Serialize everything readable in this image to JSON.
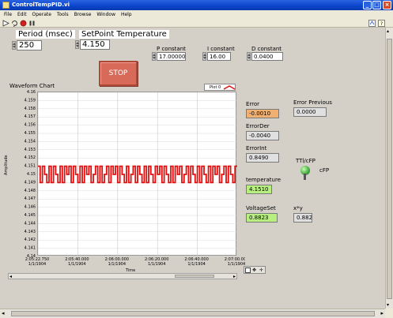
{
  "window": {
    "title": "ControlTempPID.vi",
    "minimize_glyph": "_",
    "maximize_glyph": "□",
    "close_glyph": "×"
  },
  "menu": [
    "File",
    "Edit",
    "Operate",
    "Tools",
    "Browse",
    "Window",
    "Help"
  ],
  "toolbar": {
    "icons": [
      "run-arrow-icon",
      "run-continuous-icon",
      "abort-icon",
      "pause-icon"
    ],
    "right_icons": [
      "vi-icon",
      "help-icon"
    ]
  },
  "controls": {
    "period_label": "Period (msec)",
    "period_value": "250",
    "setpoint_label": "SetPoint Temperature",
    "setpoint_value": "4.150",
    "p_label": "P constant",
    "p_value": "17.00000",
    "i_label": "I constant",
    "i_value": "16.00",
    "d_label": "D constant",
    "d_value": "0.0400",
    "stop_label": "STOP"
  },
  "indicators": {
    "error_label": "Error",
    "error_value": "-0.0010",
    "error_prev_label": "Error Previous",
    "error_prev_value": "0.0000",
    "errorder_label": "ErrorDer",
    "errorder_value": "-0.0040",
    "errorint_label": "ErrorInt",
    "errorint_value": "0.8490",
    "ttl_label": "TTl/cFP",
    "cfp_label": "cFP",
    "temperature_label": "temperature",
    "temperature_value": "4.1510",
    "voltageset_label": "VoltageSet",
    "voltageset_value": "0.8823",
    "xy_label": "x*y",
    "xy_value": "0.8823"
  },
  "colors": {
    "error_bg": "#f0b070",
    "temperature_bg": "#b8f080",
    "voltage_bg": "#b8f080",
    "readonly_bg": "#e0e0e0",
    "plot_line": "#e01010",
    "stop_button": "#d86a5a"
  },
  "chart_data": {
    "type": "line",
    "title": "Waveform Chart",
    "legend": "Plot 0",
    "ylabel": "Amplitude",
    "xlabel": "Time",
    "ylim": [
      4.14,
      4.16
    ],
    "y_ticks": [
      "4.16",
      "4.159",
      "4.158",
      "4.157",
      "4.156",
      "4.155",
      "4.154",
      "4.153",
      "4.152",
      "4.151",
      "4.15",
      "4.149",
      "4.148",
      "4.147",
      "4.146",
      "4.145",
      "4.144",
      "4.143",
      "4.142",
      "4.141",
      "4.14"
    ],
    "x_ticks": [
      {
        "time": "2:05:22.750",
        "date": "1/1/1904"
      },
      {
        "time": "2:05:40.000",
        "date": "1/1/1904"
      },
      {
        "time": "2:06:00.000",
        "date": "1/1/1904"
      },
      {
        "time": "2:06:20.000",
        "date": "1/1/1904"
      },
      {
        "time": "2:06:40.000",
        "date": "1/1/1904"
      },
      {
        "time": "2:07:00.000",
        "date": "1/1/1904"
      }
    ],
    "grid": true,
    "series": [
      {
        "values": [
          4.151,
          4.149,
          4.151,
          4.15,
          4.149,
          4.151,
          4.149,
          4.151,
          4.15,
          4.149,
          4.151,
          4.149,
          4.151,
          4.15,
          4.151,
          4.149,
          4.151,
          4.15,
          4.149,
          4.151,
          4.149,
          4.151,
          4.15,
          4.151,
          4.149,
          4.15,
          4.151,
          4.149,
          4.151,
          4.149,
          4.15,
          4.151,
          4.149,
          4.151,
          4.15,
          4.151,
          4.149,
          4.151,
          4.15,
          4.149,
          4.151,
          4.149,
          4.15,
          4.151,
          4.149,
          4.151,
          4.15,
          4.149,
          4.151,
          4.149,
          4.151,
          4.15,
          4.149,
          4.151,
          4.15,
          4.151,
          4.149,
          4.151,
          4.15,
          4.149,
          4.151,
          4.149,
          4.151,
          4.15,
          4.151,
          4.149,
          4.15,
          4.151,
          4.149,
          4.151,
          4.15,
          4.149,
          4.151,
          4.149,
          4.151,
          4.15,
          4.149,
          4.151,
          4.149,
          4.151,
          4.15,
          4.151,
          4.149,
          4.15,
          4.151,
          4.149,
          4.151,
          4.15,
          4.149,
          4.151
        ]
      }
    ]
  }
}
